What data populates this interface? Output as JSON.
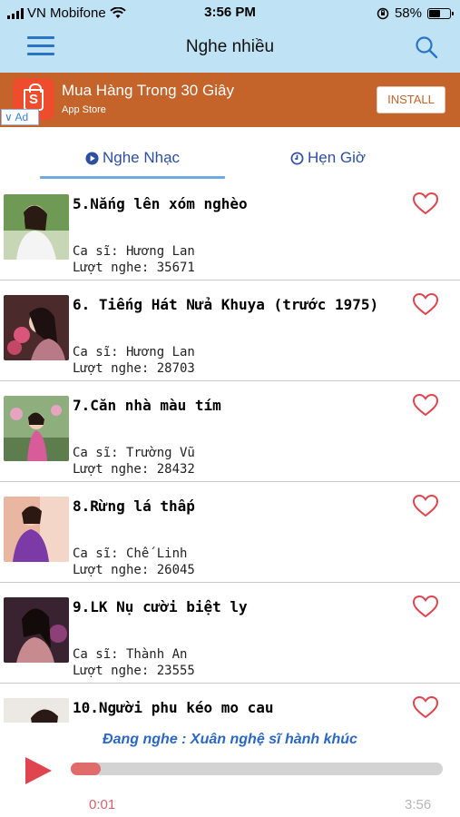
{
  "status_bar": {
    "carrier": "VN Mobifone",
    "time": "3:56 PM",
    "battery": "58%",
    "battery_level": 0.58
  },
  "nav": {
    "title": "Nghe nhiều",
    "menu_icon": "hamburger-menu-icon",
    "search_icon": "search-icon"
  },
  "ad": {
    "title": "Mua Hàng Trong 30 Giây",
    "subtitle": "App Store",
    "button": "INSTALL",
    "badge": "Ad",
    "icon": "shopee-bag-icon",
    "background_color": "#c4632a"
  },
  "tabs": [
    {
      "label": "Nghe Nhạc",
      "icon": "play-circle-icon",
      "active": true
    },
    {
      "label": "Hẹn Giờ",
      "icon": "clock-icon",
      "active": false
    }
  ],
  "songs": [
    {
      "title": "5.Nắng lên xóm nghèo",
      "singer": "Ca sĩ: Hương Lan",
      "plays": "Lượt nghe: 35671"
    },
    {
      "title": "6. Tiếng Hát Nửa Khuya (trước 1975)",
      "singer": "Ca sĩ: Hương Lan",
      "plays": "Lượt nghe: 28703"
    },
    {
      "title": "7.Căn nhà màu tím",
      "singer": "Ca sĩ: Trường Vũ",
      "plays": "Lượt nghe: 28432"
    },
    {
      "title": "8.Rừng lá thấp",
      "singer": "Ca sĩ: Chế Linh",
      "plays": "Lượt nghe: 26045"
    },
    {
      "title": "9.LK Nụ cười biệt ly",
      "singer": "Ca sĩ: Thành An",
      "plays": "Lượt nghe: 23555"
    },
    {
      "title": "10.Người phu kéo mo cau",
      "singer": "",
      "plays": ""
    }
  ],
  "player": {
    "now_playing": "Đang nghe : Xuân nghệ sĩ hành khúc",
    "current_time": "0:01",
    "total_time": "3:56",
    "progress": 0.08,
    "accent_color": "#e0444f"
  }
}
